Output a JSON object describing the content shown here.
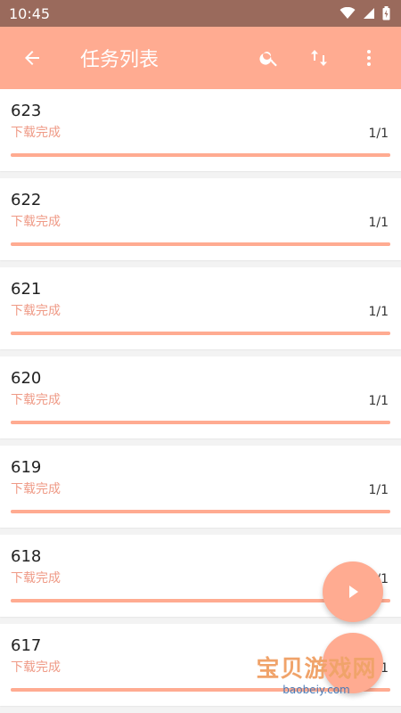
{
  "statusbar": {
    "time": "10:45"
  },
  "appbar": {
    "title": "任务列表"
  },
  "tasks": [
    {
      "name": "623",
      "status": "下载完成",
      "count": "1/1",
      "progress": 1.0
    },
    {
      "name": "622",
      "status": "下载完成",
      "count": "1/1",
      "progress": 1.0
    },
    {
      "name": "621",
      "status": "下载完成",
      "count": "1/1",
      "progress": 1.0
    },
    {
      "name": "620",
      "status": "下载完成",
      "count": "1/1",
      "progress": 1.0
    },
    {
      "name": "619",
      "status": "下载完成",
      "count": "1/1",
      "progress": 1.0
    },
    {
      "name": "618",
      "status": "下载完成",
      "count": "1/1",
      "progress": 1.0
    },
    {
      "name": "617",
      "status": "下载完成",
      "count": "1/1",
      "progress": 1.0
    }
  ],
  "watermark": {
    "title": "宝贝游戏网",
    "site": "baobeiy.com"
  },
  "colors": {
    "accent": "#ffab91",
    "statusbar": "#9a6a5c",
    "status_text": "#ef9a86"
  },
  "icons": {
    "back": "arrow-left-icon",
    "search": "search-icon",
    "sort": "sort-arrows-icon",
    "more": "more-vertical-icon",
    "play": "play-icon"
  }
}
